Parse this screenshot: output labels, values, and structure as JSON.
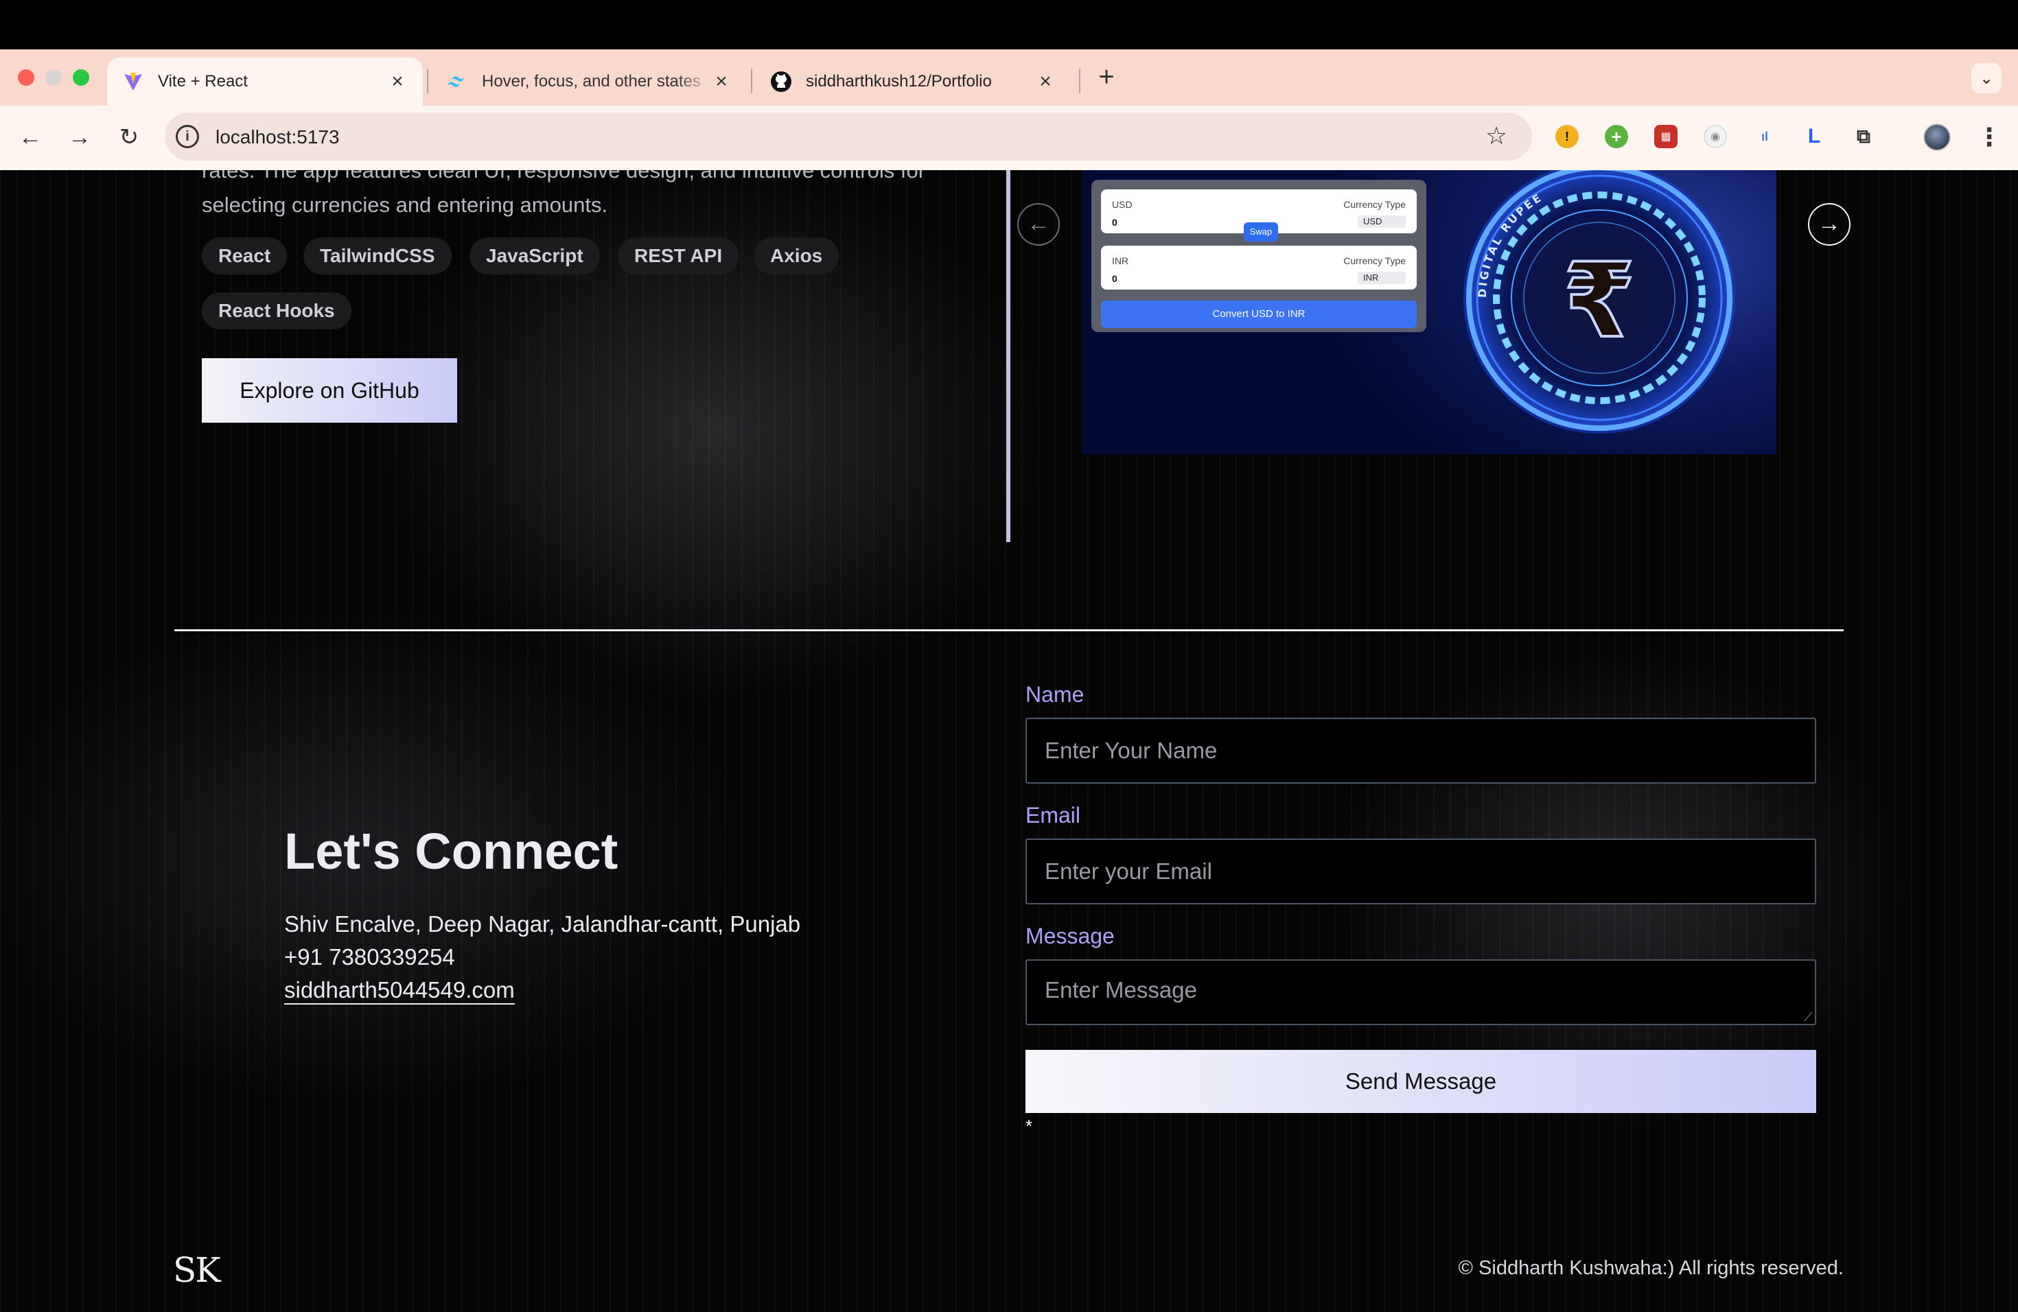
{
  "browser": {
    "tabs": [
      {
        "title": "Vite + React",
        "favicon": "vite-logo-icon",
        "active": true
      },
      {
        "title": "Hover, focus, and other states",
        "favicon": "tailwind-logo-icon",
        "active": false
      },
      {
        "title": "siddharthkush12/Portfolio",
        "favicon": "github-logo-icon",
        "active": false
      }
    ],
    "url": "localhost:5173",
    "new_tab_symbol": "+",
    "close_symbol": "×"
  },
  "project": {
    "description": "rates. The app features clean UI, responsive design, and intuitive controls for selecting currencies and entering amounts.",
    "tags": [
      "React",
      "TailwindCSS",
      "JavaScript",
      "REST API",
      "Axios",
      "React Hooks"
    ],
    "github_button": "Explore on GitHub",
    "screenshot": {
      "from_label": "USD",
      "to_label": "INR",
      "currency_type_label": "Currency Type",
      "from_value": "0",
      "to_value": "0",
      "from_currency": "USD",
      "to_currency": "INR",
      "swap_label": "Swap",
      "convert_label": "Convert USD to INR",
      "coin_text": "DIGITAL RUPEE"
    }
  },
  "contact": {
    "heading": "Let's Connect",
    "address": "Shiv Encalve, Deep Nagar, Jalandhar-cantt, Punjab",
    "phone": "+91 7380339254",
    "email": "siddharth5044549.com"
  },
  "form": {
    "name_label": "Name",
    "name_placeholder": "Enter Your Name",
    "email_label": "Email",
    "email_placeholder": "Enter your Email",
    "message_label": "Message",
    "message_placeholder": "Enter Message",
    "submit_label": "Send Message",
    "required_note": "*"
  },
  "footer": {
    "logo": "SK",
    "copyright": "© Siddharth Kushwaha:) All rights reserved."
  },
  "colors": {
    "accent_label": "#a9a2f5",
    "button_gradient_start": "#f3f3f7",
    "button_gradient_end": "#c9cbf7",
    "tabstrip": "#f8d9cb"
  }
}
